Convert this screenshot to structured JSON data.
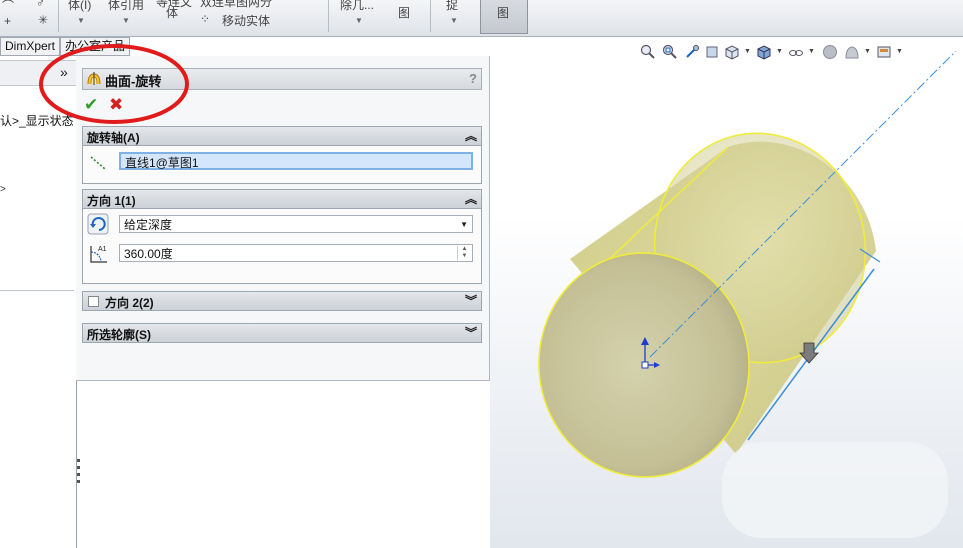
{
  "ribbon": {
    "items": [
      "体(I)",
      "体引用",
      "体",
      "移动实体",
      "除几...",
      "图",
      "捉",
      "图"
    ],
    "partial_top": [
      "等连文",
      "双连草图两分"
    ]
  },
  "tabs": [
    "DimXpert",
    "办公室产品"
  ],
  "tree": {
    "expand_glyph": "»",
    "config_text": "认>_显示状态",
    "caret": ">"
  },
  "property_manager": {
    "title": "曲面-旋转",
    "help": "?",
    "ok_glyph": "✔",
    "cancel_glyph": "✖",
    "axis_group": {
      "title": "旋转轴(A)",
      "value": "直线1@草图1"
    },
    "direction1": {
      "title": "方向 1(1)",
      "end_condition": "给定深度",
      "angle": "360.00度"
    },
    "direction2": {
      "title": "方向 2(2)",
      "checked": false
    },
    "selected_contours": {
      "title": "所选轮廓(S)"
    }
  },
  "viewport": {
    "heads_up_icons": [
      "zoom-to-fit-icon",
      "zoom-area-icon",
      "previous-view-icon",
      "section-view-icon",
      "view-orientation-icon",
      "display-style-icon",
      "hide-show-items-icon",
      "edit-appearance-icon",
      "apply-scene-icon",
      "view-settings-icon"
    ],
    "colors": {
      "surface_fill": "#d6d49a",
      "surface_edge": "#f0ee3a",
      "axis": "#3a8fd8",
      "triad": "#1b3fd0"
    }
  },
  "annotation": {
    "color": "#e01b1b"
  }
}
